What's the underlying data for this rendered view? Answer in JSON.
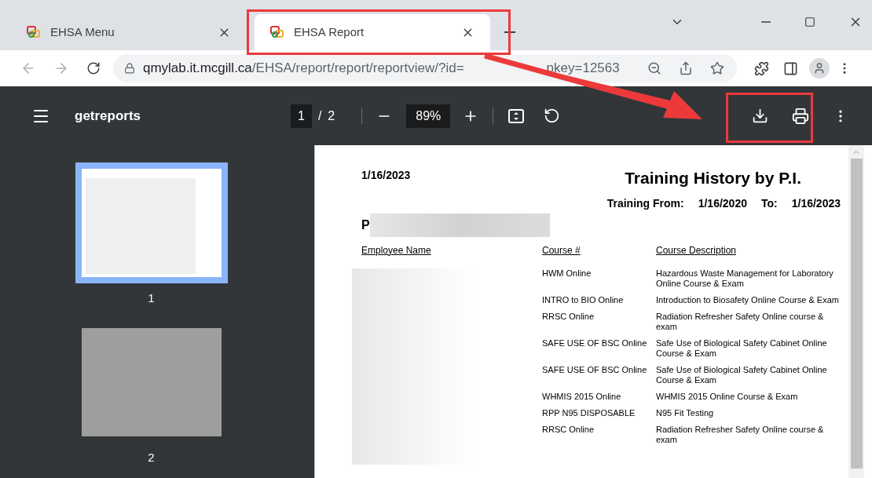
{
  "tabs": [
    {
      "title": "EHSA Menu",
      "selected": false
    },
    {
      "title": "EHSA Report",
      "selected": true
    }
  ],
  "address_bar": {
    "host": "qmylab.it.mcgill.ca",
    "path": "/EHSA/report/report/reportview/?id=",
    "path_end": "pkey=12563"
  },
  "pdf_toolbar": {
    "title": "getreports",
    "page": "1",
    "separator": "/",
    "page_count": "2",
    "zoom": "89%"
  },
  "thumbnails": [
    {
      "label": "1",
      "selected": true
    },
    {
      "label": "2",
      "selected": false
    }
  ],
  "report": {
    "date": "1/16/2023",
    "title": "Training History by P.I.",
    "range_label": "Training From:",
    "from": "1/16/2020",
    "to_label": "To:",
    "to": "1/16/2023",
    "pi_initial": "P",
    "columns": [
      "Employee Name",
      "Course #",
      "Course Description"
    ],
    "rows": [
      {
        "course": "HWM Online",
        "description": "Hazardous Waste Management for Laboratory Online Course & Exam"
      },
      {
        "course": "INTRO to BIO Online",
        "description": "Introduction to Biosafety Online Course & Exam"
      },
      {
        "course": "RRSC Online",
        "description": "Radiation Refresher Safety Online course & exam"
      },
      {
        "course": "SAFE USE OF BSC Online",
        "description": "Safe Use of Biological Safety Cabinet Online Course & Exam"
      },
      {
        "course": "SAFE USE OF BSC Online",
        "description": "Safe Use of Biological Safety Cabinet Online Course & Exam"
      },
      {
        "course": "WHMIS 2015 Online",
        "description": "WHMIS 2015 Online Course & Exam"
      },
      {
        "course": "RPP N95 DISPOSABLE",
        "description": "N95 Fit Testing"
      },
      {
        "course": "RRSC Online",
        "description": "Radiation Refresher Safety Online course & exam"
      }
    ]
  }
}
